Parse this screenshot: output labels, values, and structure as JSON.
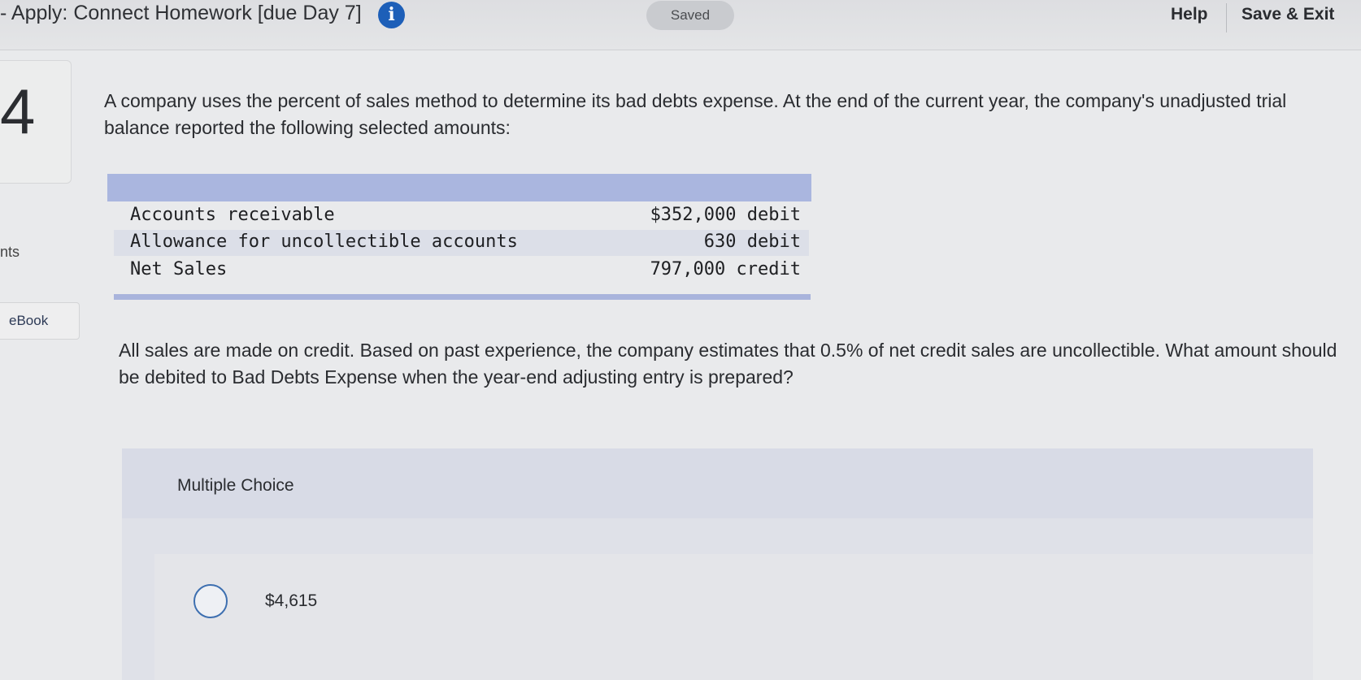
{
  "header": {
    "title": "- Apply: Connect Homework [due Day 7]",
    "info_glyph": "i",
    "info_icon": "info-icon",
    "status": "Saved",
    "help_label": "Help",
    "save_exit_label": "Save & Exit"
  },
  "sidebar": {
    "question_number": "4",
    "points_label": "nts",
    "ebook_label": "eBook"
  },
  "question": {
    "prompt": "A company uses the percent of sales method to determine its bad debts expense. At the end of the current year, the company's unadjusted trial balance reported the following selected amounts:",
    "table": [
      {
        "label": "Accounts receivable",
        "value": "$352,000 debit"
      },
      {
        "label": "Allowance for uncollectible accounts",
        "value": "630 debit"
      },
      {
        "label": "Net Sales",
        "value": "797,000 credit"
      }
    ],
    "text": "All sales are made on credit. Based on past experience, the company estimates that 0.5% of net credit sales are uncollectible. What amount should be debited to Bad Debts Expense when the year-end adjusting entry is prepared?"
  },
  "multiple_choice": {
    "title": "Multiple Choice",
    "options": [
      {
        "label": "$4,615",
        "selected": false
      }
    ]
  },
  "colors": {
    "accent": "#1d5fb8",
    "table_header": "#aab6df",
    "row_shade": "#dcdfe8"
  }
}
